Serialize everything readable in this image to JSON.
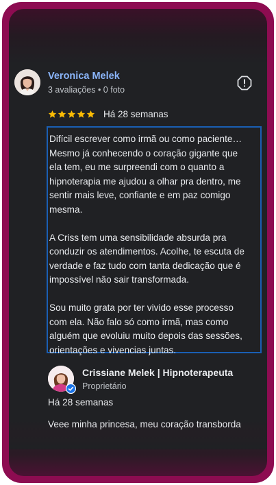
{
  "review": {
    "reviewer_name": "Veronica Melek",
    "reviewer_meta": "3 avaliações • 0 foto",
    "rating": 5,
    "date": "Há 28 semanas",
    "paragraphs": [
      [
        "Difícil escrever como irmã ou como paciente…",
        "Mesmo já conhecendo o coração gigante que",
        "ela tem, eu me surpreendi com o quanto a",
        "hipnoterapia me ajudou a olhar pra dentro, me",
        "sentir mais leve, confiante e em paz comigo",
        "mesma."
      ],
      [
        "A Criss tem uma sensibilidade absurda pra",
        "conduzir os atendimentos. Acolhe, te escuta de",
        "verdade e faz tudo com tanta dedicação que é",
        "impossível não sair transformada."
      ],
      [
        "Sou muito grata por ter vivido esse processo",
        "com ela. Não falo só como irmã, mas como",
        "alguém que evoluiu muito depois das sessões,",
        "orientações e vivencias juntas."
      ]
    ]
  },
  "owner_reply": {
    "name": "Crissiane Melek | Hipnoterapeuta",
    "role": "Proprietário",
    "date": "Há 28 semanas",
    "text": "Veee minha princesa, meu coração transborda"
  },
  "icons": {
    "report": "report-flag-icon",
    "star": "star-icon",
    "verified": "verified-badge-icon"
  },
  "colors": {
    "frame": "#8d0c51",
    "link": "#8ab4f8",
    "star": "#fbbc04",
    "highlight_border": "#1a5fb4",
    "verified": "#1a73e8"
  }
}
